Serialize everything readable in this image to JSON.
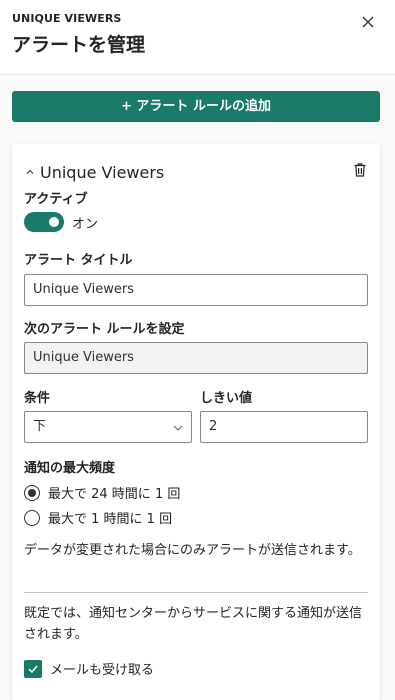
{
  "panel": {
    "eyebrow": "UNIQUE VIEWERS",
    "title": "アラートを管理",
    "close_icon": "close-icon"
  },
  "add_rule_button": {
    "label": "+ アラート ルールの追加"
  },
  "rule": {
    "name": "Unique Viewers",
    "expanded": true,
    "active_label": "アクティブ",
    "toggle": {
      "on": true,
      "text": "オン"
    },
    "alert_title_label": "アラート タイトル",
    "alert_title_value": "Unique Viewers",
    "set_rule_label": "次のアラート ルールを設定",
    "set_rule_value": "Unique Viewers",
    "condition_label": "条件",
    "condition_value": "下",
    "threshold_label": "しきい値",
    "threshold_value": "2",
    "frequency_label": "通知の最大頻度",
    "frequency_options": [
      {
        "label": "最大で 24 時間に 1 回",
        "checked": true
      },
      {
        "label": "最大で 1 時間に 1 回",
        "checked": false
      }
    ],
    "data_change_note": "データが変更された場合にのみアラートが送信されます。",
    "default_note": "既定では、通知センターからサービスに関する通知が送信されます。",
    "email_checkbox": {
      "label": "メールも受け取る",
      "checked": true
    }
  },
  "colors": {
    "accent": "#1a7a6a",
    "text": "#252423",
    "border": "#8a8886"
  }
}
